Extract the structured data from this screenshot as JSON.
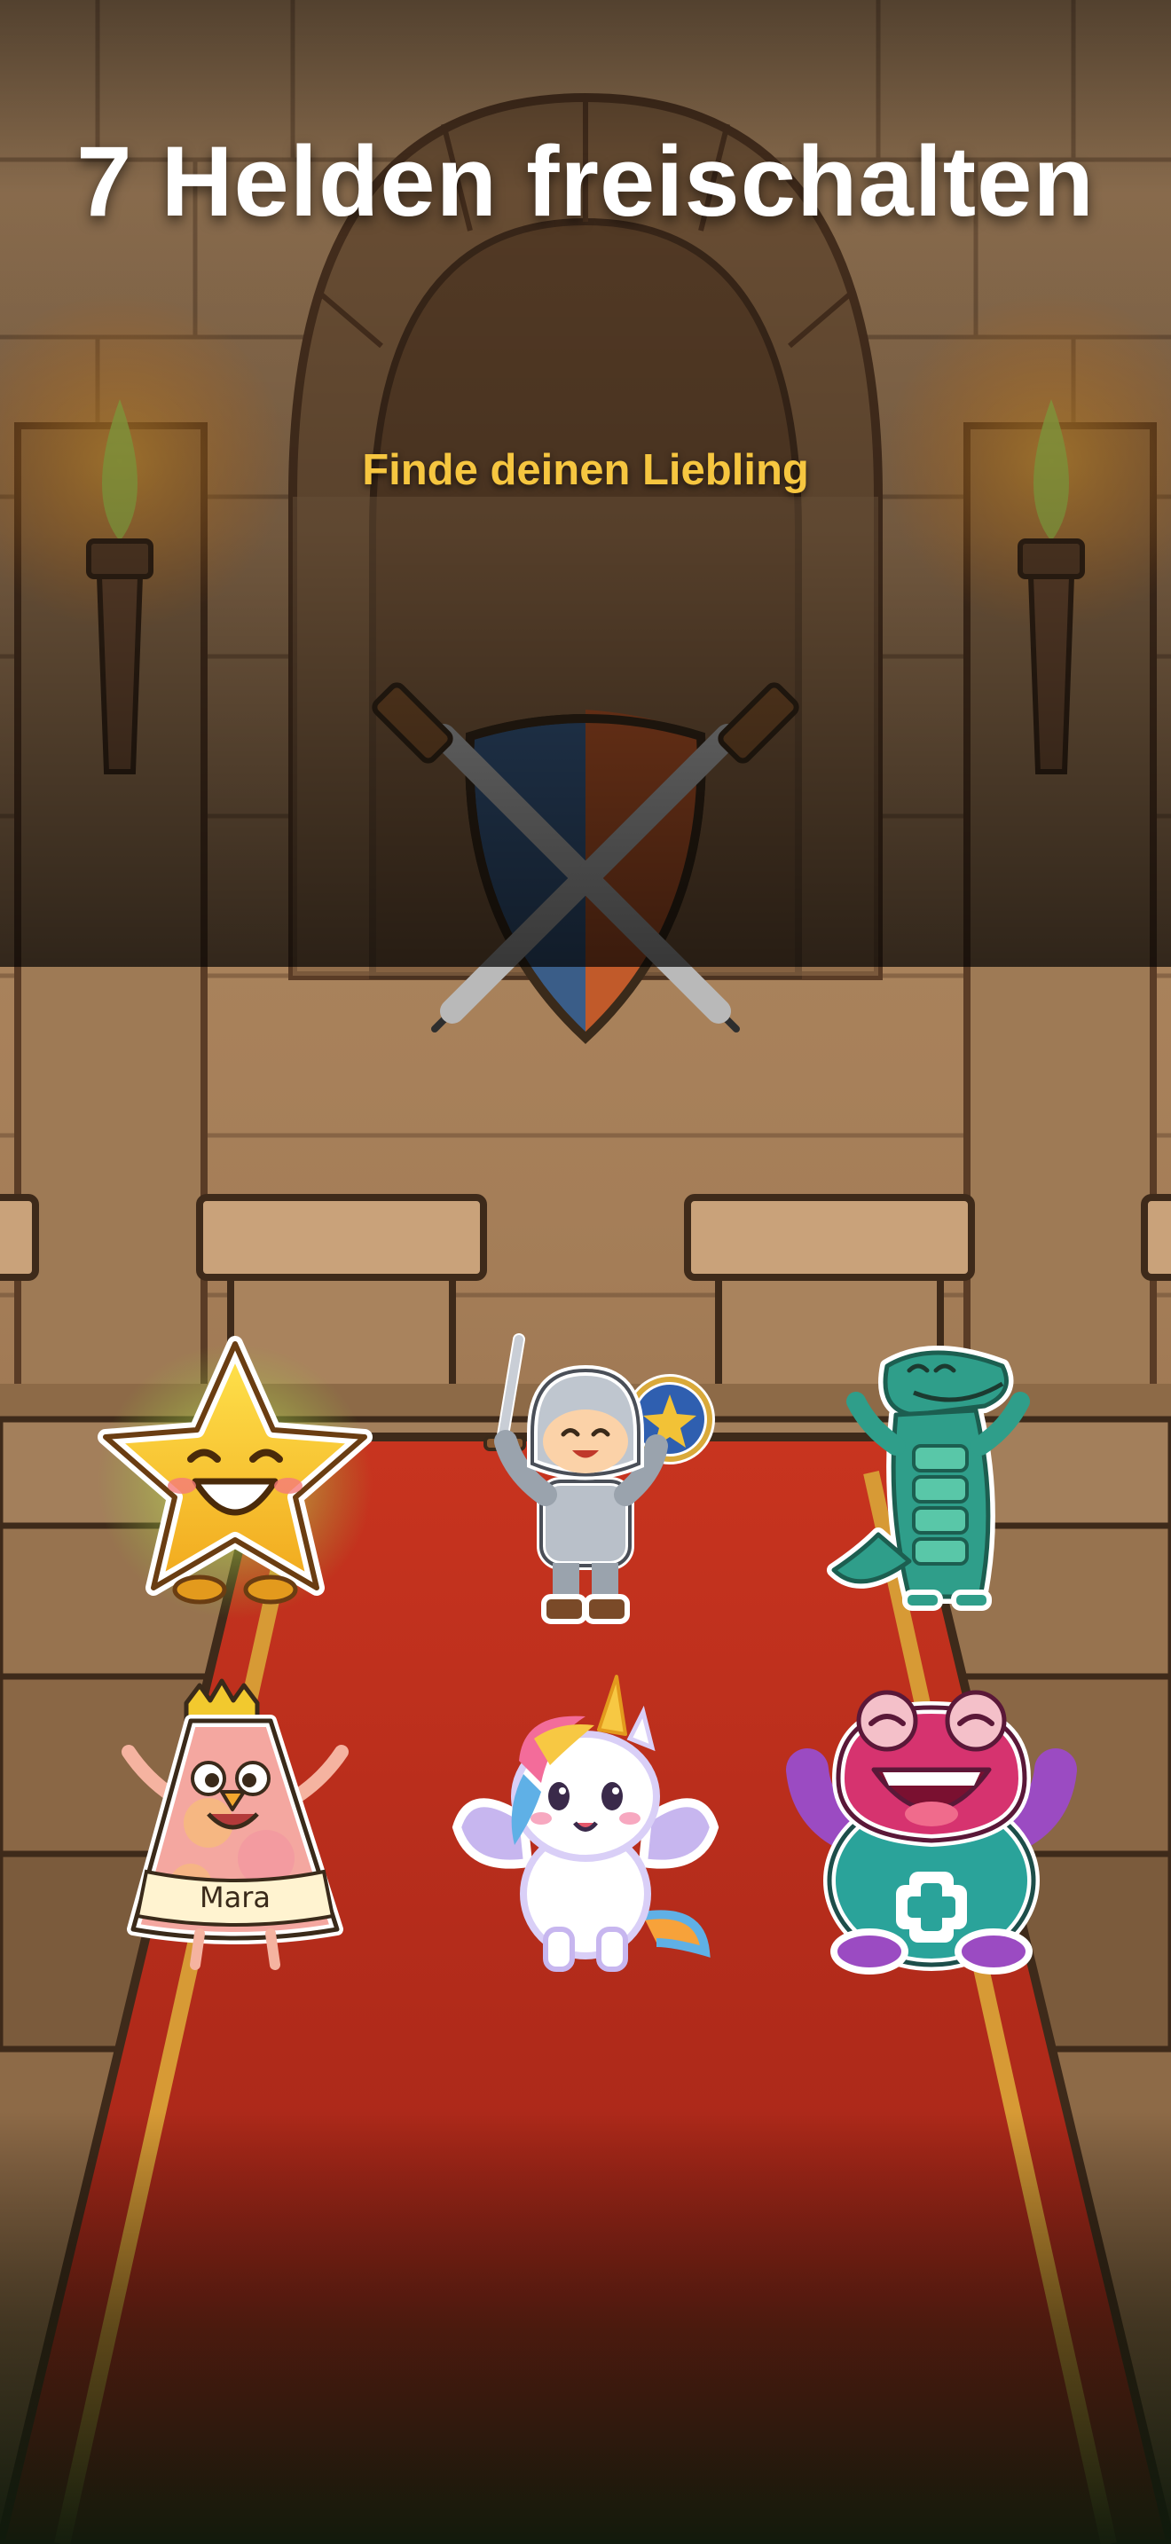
{
  "header": {
    "title": "7 Helden freischalten",
    "subtitle": "Finde deinen Liebling"
  },
  "heroes": [
    {
      "id": "star",
      "icon": "star-hero-icon"
    },
    {
      "id": "knight",
      "icon": "knight-hero-icon"
    },
    {
      "id": "crocodile",
      "icon": "crocodile-hero-icon"
    },
    {
      "id": "mara",
      "icon": "mara-hero-icon",
      "name_tag": "Mara"
    },
    {
      "id": "unicorn",
      "icon": "unicorn-hero-icon"
    },
    {
      "id": "frog",
      "icon": "frog-hero-icon"
    }
  ],
  "colors": {
    "title": "#ffffff",
    "subtitle": "#f6c640",
    "carpet": "#b52a1b",
    "carpet_trim": "#d79a35",
    "stone": "#b48e66"
  }
}
